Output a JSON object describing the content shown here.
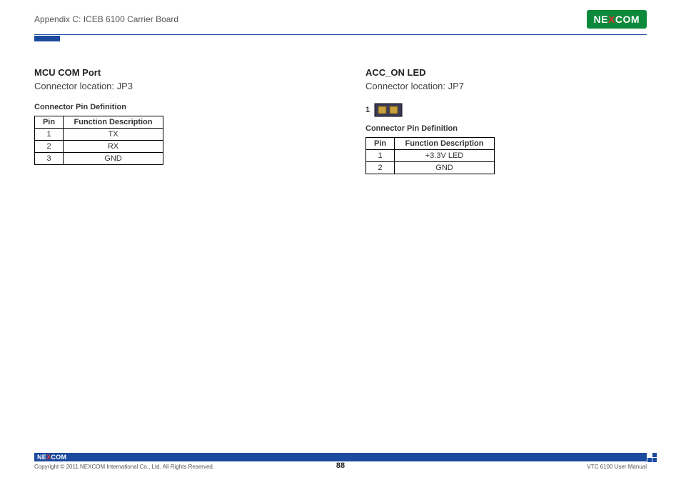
{
  "header": {
    "appendix": "Appendix C: ICEB 6100 Carrier Board",
    "brand_pre": "NE",
    "brand_x": "X",
    "brand_post": "COM"
  },
  "left": {
    "title": "MCU COM Port",
    "subtitle": "Connector location: JP3",
    "table_caption": "Connector Pin Definition",
    "headers": {
      "pin": "Pin",
      "func": "Function Description"
    },
    "rows": [
      {
        "pin": "1",
        "func": "TX"
      },
      {
        "pin": "2",
        "func": "RX"
      },
      {
        "pin": "3",
        "func": "GND"
      }
    ]
  },
  "right": {
    "title": "ACC_ON LED",
    "subtitle": "Connector location: JP7",
    "pin1_label": "1",
    "table_caption": "Connector Pin Definition",
    "headers": {
      "pin": "Pin",
      "func": "Function Description"
    },
    "rows": [
      {
        "pin": "1",
        "func": "+3.3V LED"
      },
      {
        "pin": "2",
        "func": "GND"
      }
    ]
  },
  "footer": {
    "brand_pre": "NE",
    "brand_x": "X",
    "brand_post": "COM",
    "copyright": "Copyright © 2011 NEXCOM International Co., Ltd. All Rights Reserved.",
    "page": "88",
    "doc": "VTC 6100 User Manual"
  }
}
